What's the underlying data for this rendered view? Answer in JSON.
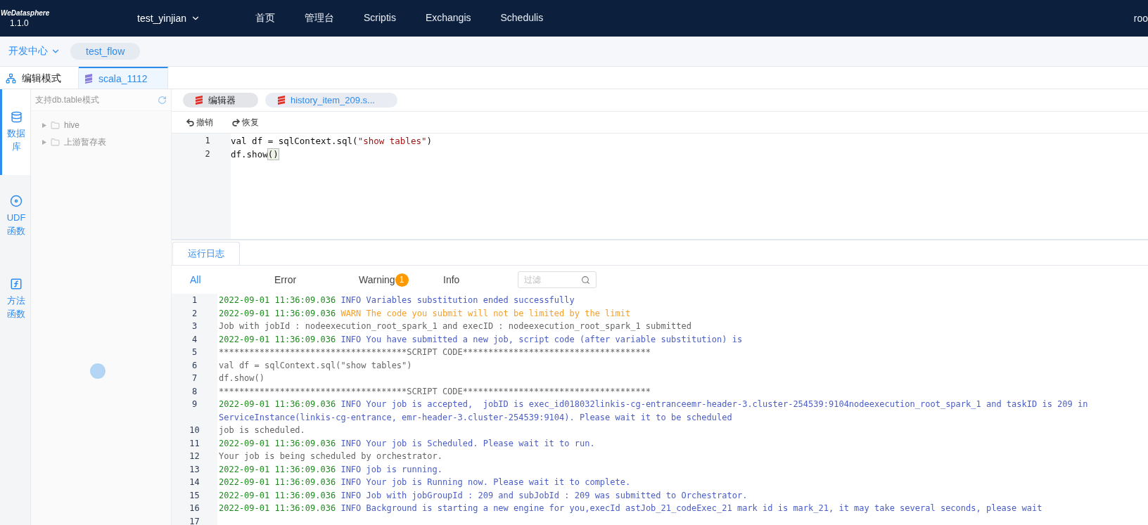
{
  "header": {
    "logo": "WeDatasphere",
    "version": "1.1.0",
    "workspace": "test_yinjian",
    "nav": [
      {
        "label": "首页"
      },
      {
        "label": "管理台"
      },
      {
        "label": "Scriptis"
      },
      {
        "label": "Exchangis"
      },
      {
        "label": "Schedulis"
      }
    ],
    "user": "roo"
  },
  "subbar": {
    "center": "开发中心",
    "flow": "test_flow"
  },
  "tabs": [
    {
      "label": "编辑模式",
      "kind": "tree",
      "selected": false
    },
    {
      "label": "scala_1112",
      "kind": "script",
      "selected": true
    }
  ],
  "side_nav": [
    {
      "label": "数据库",
      "kind": "database",
      "selected": true
    },
    {
      "label": "UDF函数",
      "kind": "udf",
      "selected": false
    },
    {
      "label": "方法函数",
      "kind": "function",
      "selected": false
    }
  ],
  "db_panel": {
    "search_placeholder": "支持db.table模式",
    "tree": [
      {
        "label": "hive"
      },
      {
        "label": "上游暂存表"
      }
    ],
    "loading": true
  },
  "editor_tabs": [
    {
      "label": "编辑器",
      "selected": true
    },
    {
      "label": "history_item_209.s...",
      "selected": false
    }
  ],
  "toolbar": [
    {
      "label": "撤销",
      "kind": "undo"
    },
    {
      "label": "恢复",
      "kind": "redo"
    }
  ],
  "code": [
    {
      "number": "1",
      "parts": [
        {
          "kind": "plain",
          "text": "val df = sqlContext.sql("
        },
        {
          "kind": "string",
          "text": "\"show tables\""
        },
        {
          "kind": "plain",
          "text": ")"
        }
      ]
    },
    {
      "number": "2",
      "parts": [
        {
          "kind": "plain",
          "text": "df.show"
        },
        {
          "kind": "bracket",
          "text": "()"
        }
      ]
    }
  ],
  "log": {
    "tab": "运行日志",
    "filters": [
      {
        "label": "All",
        "selected": true
      },
      {
        "label": "Error",
        "selected": false
      },
      {
        "label": "Warning",
        "selected": false,
        "badge": "1"
      },
      {
        "label": "Info",
        "selected": false
      }
    ],
    "filter_placeholder": "过滤",
    "lines": [
      {
        "number": "1",
        "parts": [
          {
            "kind": "time",
            "text": "2022-09-01 11:36:09.036"
          },
          {
            "kind": "info",
            "text": "INFO Variables substitution ended successfully"
          }
        ]
      },
      {
        "number": "2",
        "parts": [
          {
            "kind": "time",
            "text": "2022-09-01 11:36:09.036"
          },
          {
            "kind": "warn",
            "text": "WARN The code you submit will not be limited by the limit"
          }
        ]
      },
      {
        "number": "3",
        "parts": [
          {
            "kind": "plain",
            "text": "Job with jobId : nodeexecution_root_spark_1 and execID : nodeexecution_root_spark_1 submitted"
          }
        ]
      },
      {
        "number": "4",
        "parts": [
          {
            "kind": "time",
            "text": "2022-09-01 11:36:09.036"
          },
          {
            "kind": "info",
            "text": "INFO You have submitted a new job, script code (after variable substitution) is"
          }
        ]
      },
      {
        "number": "5",
        "parts": [
          {
            "kind": "plain",
            "text": "*************************************SCRIPT CODE*************************************"
          }
        ]
      },
      {
        "number": "6",
        "parts": [
          {
            "kind": "plain",
            "text": "val df = sqlContext.sql(\"show tables\")"
          }
        ]
      },
      {
        "number": "7",
        "parts": [
          {
            "kind": "plain",
            "text": "df.show()"
          }
        ]
      },
      {
        "number": "8",
        "parts": [
          {
            "kind": "plain",
            "text": "*************************************SCRIPT CODE*************************************"
          }
        ]
      },
      {
        "number": "9",
        "parts": [
          {
            "kind": "time",
            "text": "2022-09-01 11:36:09.036"
          },
          {
            "kind": "info",
            "text": "INFO Your job is accepted,  jobID is exec_id018032linkis-cg-entranceemr-header-3.cluster-254539:9104nodeexecution_root_spark_1 and taskID is 209 in ServiceInstance(linkis-cg-entrance, emr-header-3.cluster-254539:9104). Please wait it to be scheduled"
          }
        ]
      },
      {
        "number": "10",
        "parts": [
          {
            "kind": "plain",
            "text": "job is scheduled."
          }
        ]
      },
      {
        "number": "11",
        "parts": [
          {
            "kind": "time",
            "text": "2022-09-01 11:36:09.036"
          },
          {
            "kind": "info",
            "text": "INFO Your job is Scheduled. Please wait it to run."
          }
        ]
      },
      {
        "number": "12",
        "parts": [
          {
            "kind": "plain",
            "text": "Your job is being scheduled by orchestrator."
          }
        ]
      },
      {
        "number": "13",
        "parts": [
          {
            "kind": "time",
            "text": "2022-09-01 11:36:09.036"
          },
          {
            "kind": "info",
            "text": "INFO job is running."
          }
        ]
      },
      {
        "number": "14",
        "parts": [
          {
            "kind": "time",
            "text": "2022-09-01 11:36:09.036"
          },
          {
            "kind": "info",
            "text": "INFO Your job is Running now. Please wait it to complete."
          }
        ]
      },
      {
        "number": "15",
        "parts": [
          {
            "kind": "time",
            "text": "2022-09-01 11:36:09.036"
          },
          {
            "kind": "info",
            "text": "INFO Job with jobGroupId : 209 and subJobId : 209 was submitted to Orchestrator."
          }
        ]
      },
      {
        "number": "16",
        "parts": [
          {
            "kind": "time",
            "text": "2022-09-01 11:36:09.036"
          },
          {
            "kind": "info",
            "text": "INFO Background is starting a new engine for you,execId astJob_21_codeExec_21 mark id is mark_21, it may take several seconds, please wait"
          }
        ]
      },
      {
        "number": "17"
      }
    ]
  }
}
